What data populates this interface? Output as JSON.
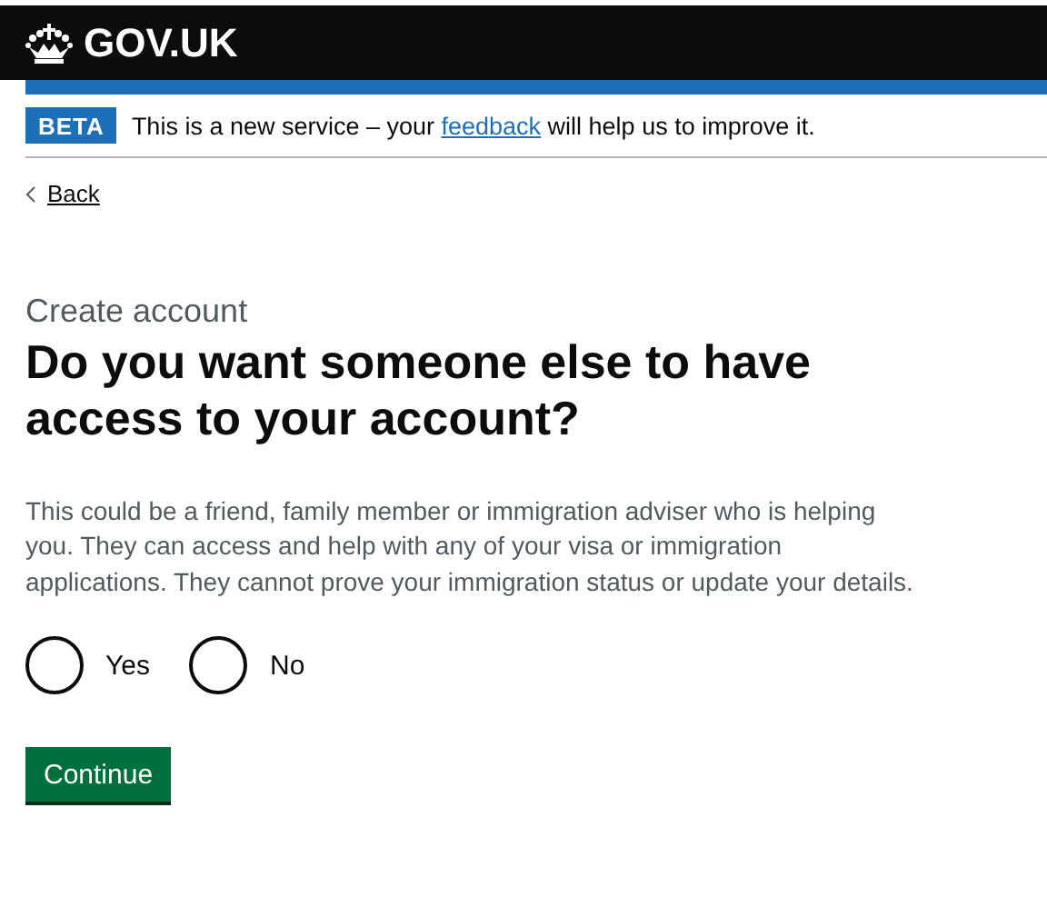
{
  "header": {
    "logo_text": "GOV.UK"
  },
  "phase_banner": {
    "tag": "BETA",
    "text_before": "This is a new service – your ",
    "link": "feedback",
    "text_after": " will help us to improve it."
  },
  "back_link": "Back",
  "caption": "Create account",
  "heading": "Do you want someone else to have access to your account?",
  "hint": "This could be a friend, family member or immigration adviser who is helping you. They can access and help with any of your visa or immigration applications. They cannot prove your immigration status or update your details.",
  "options": [
    {
      "label": "Yes",
      "selected": false
    },
    {
      "label": "No",
      "selected": false
    }
  ],
  "button": "Continue"
}
